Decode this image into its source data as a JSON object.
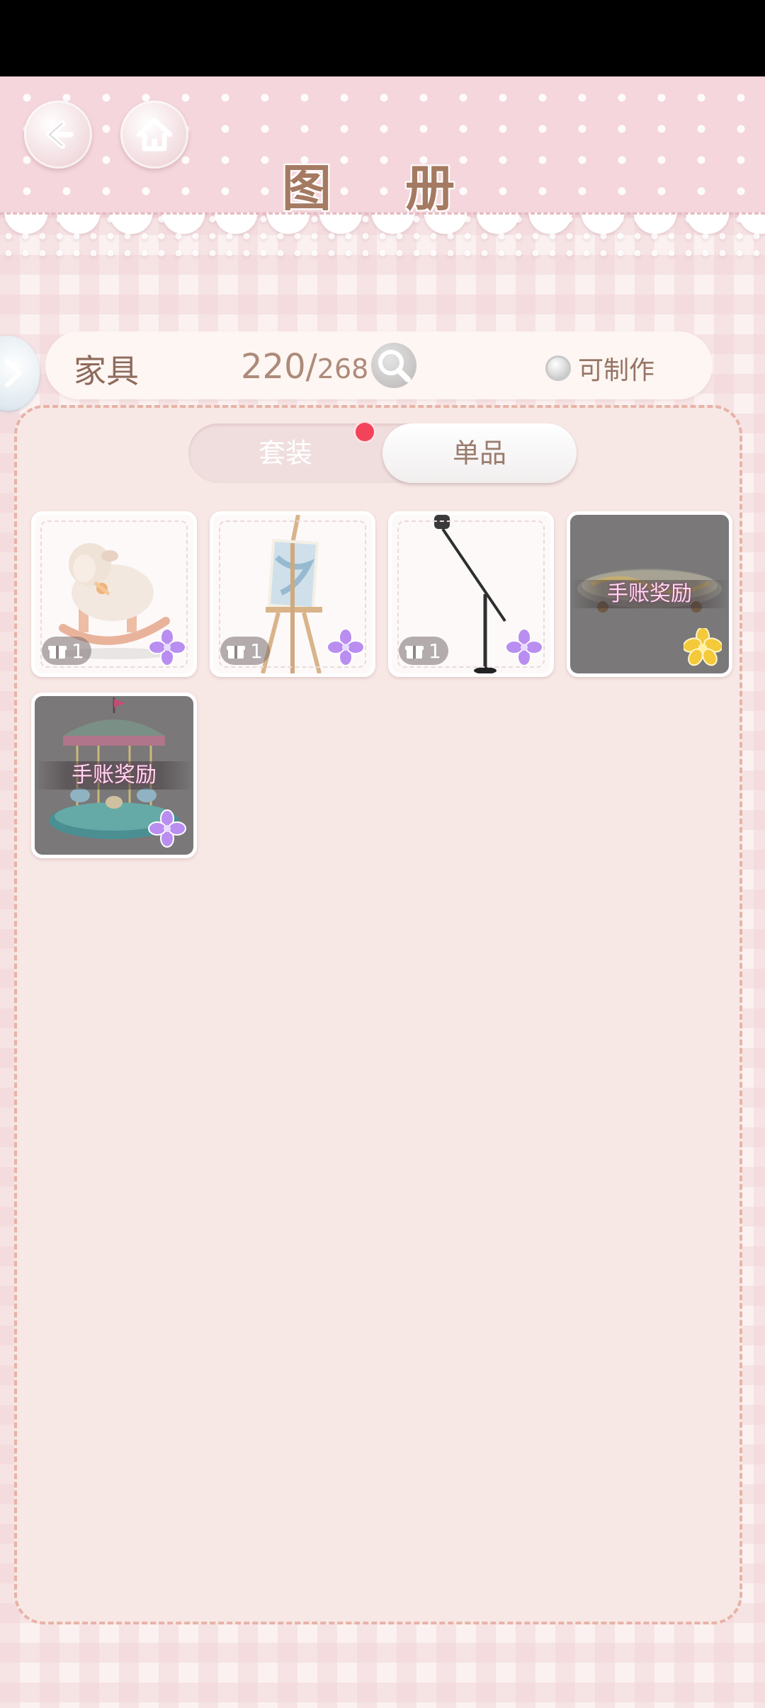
{
  "header": {
    "title": "图 册",
    "back_icon": "back-arrow-icon",
    "home_icon": "home-icon"
  },
  "info_bar": {
    "category": "家具",
    "collected": "220/",
    "total": "268",
    "search_icon": "magnifier-icon",
    "craftable_label": "可制作",
    "craftable_checked": false
  },
  "tabs": {
    "sets_label": "套装",
    "items_label": "单品",
    "active": "单品",
    "sets_has_new": true
  },
  "items": [
    {
      "name": "rocking-sheep",
      "owned": "1",
      "rarity_icon": "purple-flower-icon",
      "locked": false
    },
    {
      "name": "easel",
      "owned": "1",
      "rarity_icon": "purple-flower-icon",
      "locked": false
    },
    {
      "name": "mic-stand",
      "owned": "1",
      "rarity_icon": "purple-flower-icon",
      "locked": false
    },
    {
      "name": "skateboard",
      "reward_label": "手账奖励",
      "rarity_icon": "gold-flower-icon",
      "locked": true
    },
    {
      "name": "carousel",
      "reward_label": "手账奖励",
      "rarity_icon": "purple-flower-icon",
      "locked": true
    }
  ],
  "colors": {
    "header_pink": "#f4d6dc",
    "panel_border": "#e7b3a6",
    "notify_red": "#f3435b",
    "rare_purple": "#b98ef0",
    "rare_gold": "#f4c93a"
  }
}
